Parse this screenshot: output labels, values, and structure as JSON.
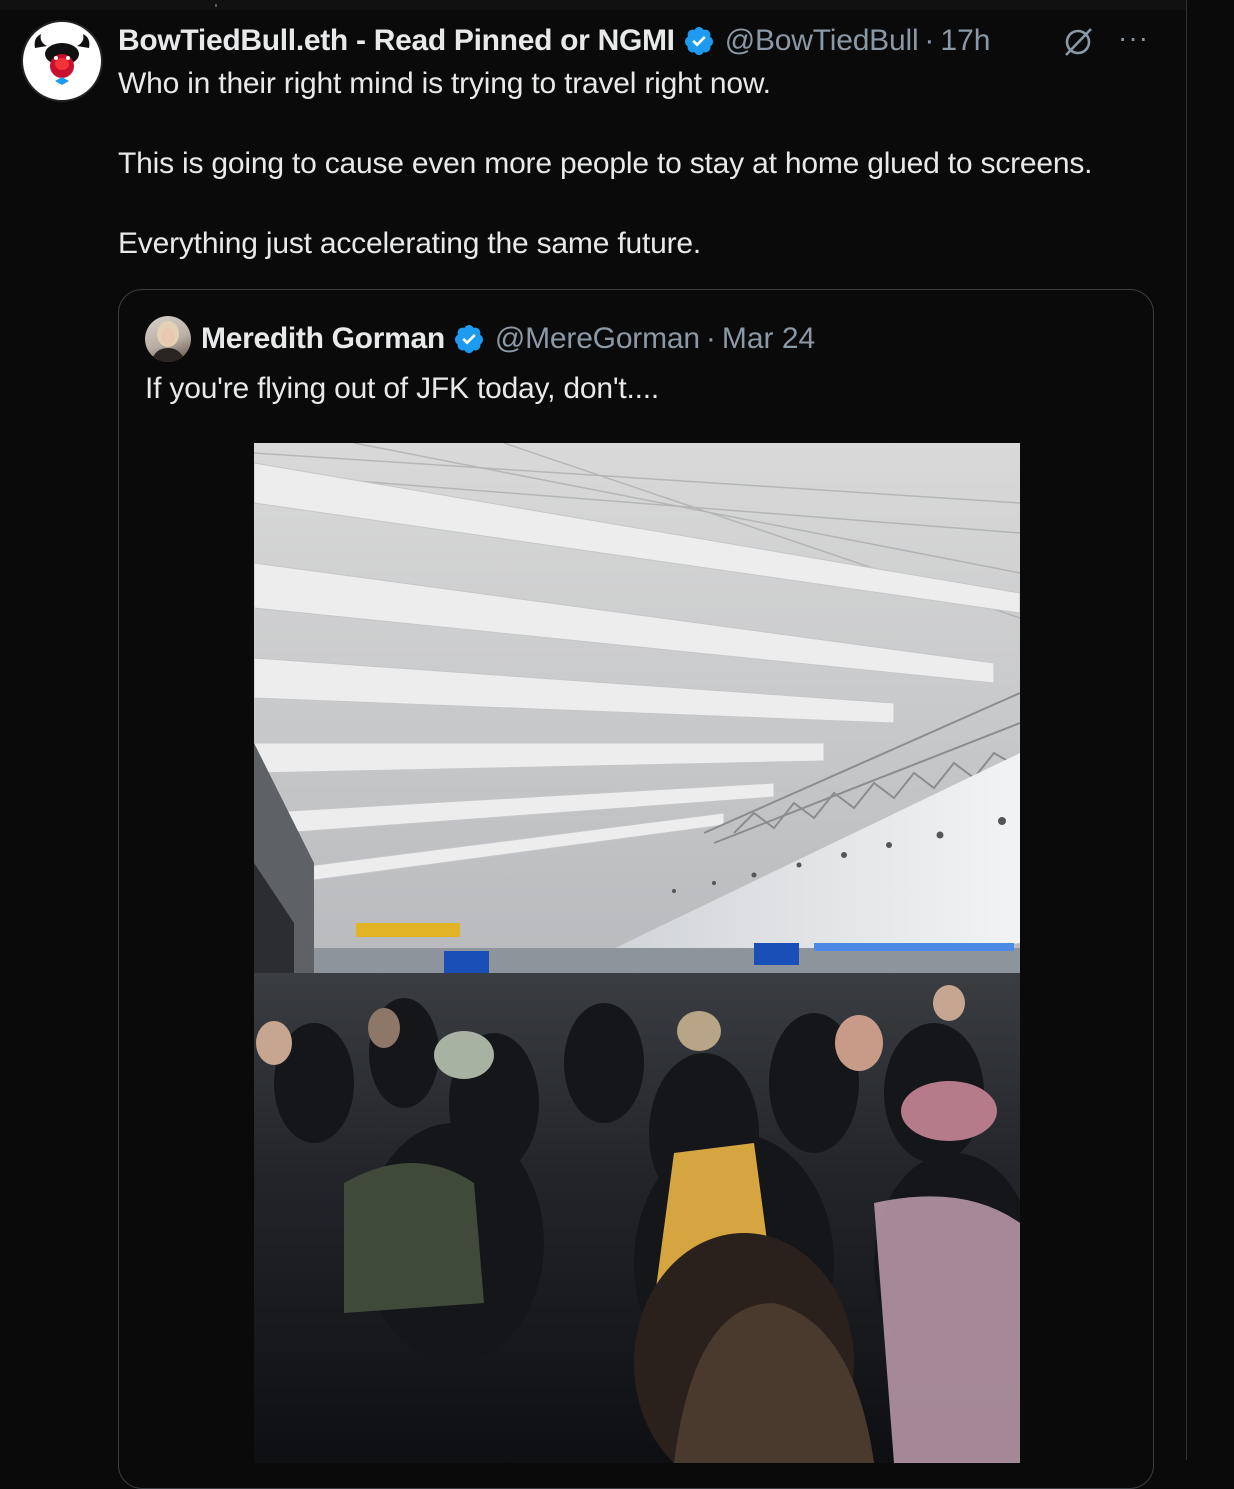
{
  "tweet": {
    "display_name": "BowTiedBull.eth - Read Pinned or NGMI",
    "handle": "@BowTiedBull",
    "separator": "·",
    "time": "17h",
    "more_icon": "···",
    "text_lines": [
      "Who in their right mind is trying to travel right now.",
      "This is going to cause even more people to stay at home glued to screens.",
      "Everything just accelerating the same future."
    ]
  },
  "quote": {
    "display_name": "Meredith Gorman",
    "handle": "@MereGorman",
    "separator": "·",
    "time": "Mar 24",
    "text": "If you're flying out of JFK today, don't....",
    "photo_alt": "Crowded airport terminal"
  },
  "colors": {
    "background": "#0a0a0a",
    "text": "#e7e9ea",
    "muted": "#8b98a5",
    "verified": "#1d9bf0",
    "border": "#3b4044"
  }
}
